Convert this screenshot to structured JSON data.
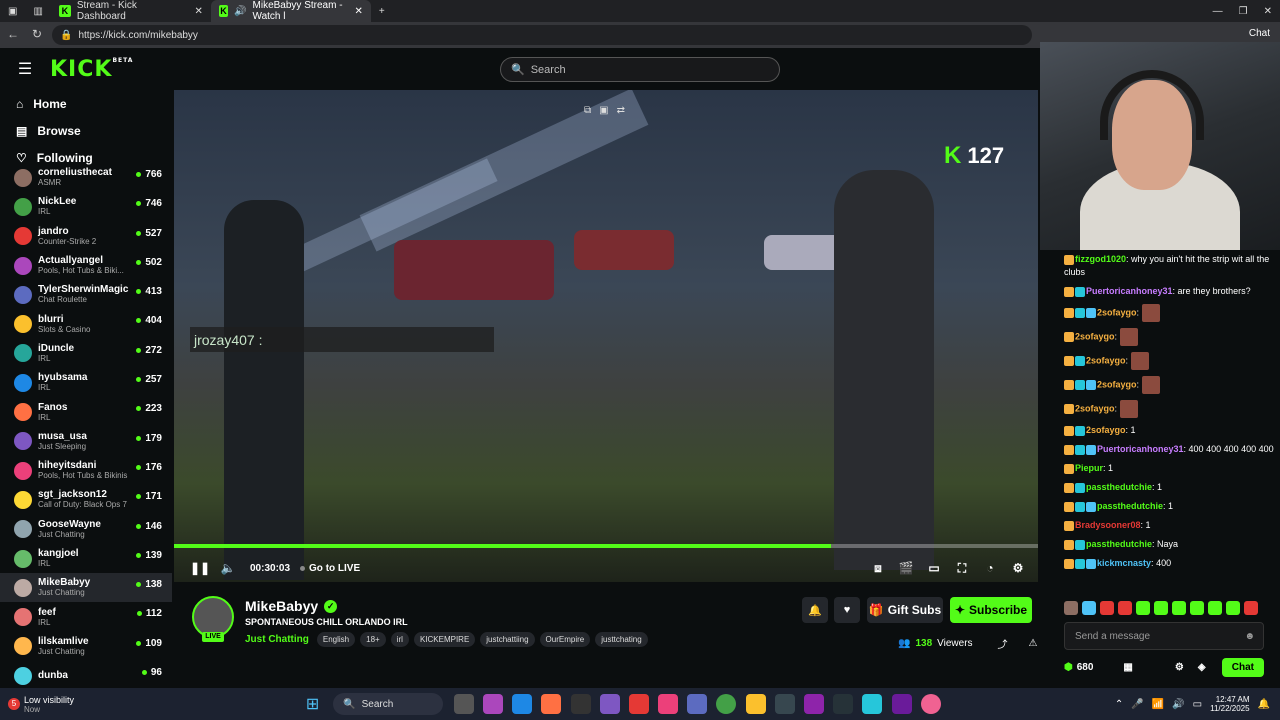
{
  "browser": {
    "tabs": [
      {
        "label": "Stream - Kick Dashboard"
      },
      {
        "label": "MikeBabyy Stream - Watch l"
      }
    ],
    "url": "https://kick.com/mikebabyy",
    "chat_label": "Chat"
  },
  "header": {
    "logo": "KICK",
    "beta": "BETA",
    "search_placeholder": "Search"
  },
  "nav": [
    {
      "label": "Home"
    },
    {
      "label": "Browse"
    },
    {
      "label": "Following"
    }
  ],
  "channels": [
    {
      "name": "corneliusthecat",
      "category": "ASMR",
      "viewers": "766"
    },
    {
      "name": "NickLee",
      "category": "IRL",
      "viewers": "746"
    },
    {
      "name": "jandro",
      "category": "Counter-Strike 2",
      "viewers": "527"
    },
    {
      "name": "Actuallyangel",
      "category": "Pools, Hot Tubs & Biki...",
      "viewers": "502"
    },
    {
      "name": "TylerSherwinMagic",
      "category": "Chat Roulette",
      "viewers": "413"
    },
    {
      "name": "blurri",
      "category": "Slots & Casino",
      "viewers": "404"
    },
    {
      "name": "iDuncle",
      "category": "IRL",
      "viewers": "272"
    },
    {
      "name": "hyubsama",
      "category": "IRL",
      "viewers": "257"
    },
    {
      "name": "Fanos",
      "category": "IRL",
      "viewers": "223"
    },
    {
      "name": "musa_usa",
      "category": "Just Sleeping",
      "viewers": "179"
    },
    {
      "name": "hiheyitsdani",
      "category": "Pools, Hot Tubs & Bikinis",
      "viewers": "176"
    },
    {
      "name": "sgt_jackson12",
      "category": "Call of Duty: Black Ops 7",
      "viewers": "171"
    },
    {
      "name": "GooseWayne",
      "category": "Just Chatting",
      "viewers": "146"
    },
    {
      "name": "kangjoel",
      "category": "IRL",
      "viewers": "139"
    },
    {
      "name": "MikeBabyy",
      "category": "Just Chatting",
      "viewers": "138"
    },
    {
      "name": "feef",
      "category": "IRL",
      "viewers": "112"
    },
    {
      "name": "lilskamlive",
      "category": "Just Chatting",
      "viewers": "109"
    },
    {
      "name": "dunba",
      "category": "",
      "viewers": "96"
    }
  ],
  "video": {
    "k_count": "127",
    "overlay_chat": "jrozay407 :",
    "time": "00:30:03",
    "go_live": "Go to LIVE",
    "progress": 0.76
  },
  "stream": {
    "name": "MikeBabyy",
    "live": "LIVE",
    "title": "SPONTANEOUS CHILL ORLANDO IRL",
    "category": "Just Chatting",
    "tags": [
      "English",
      "18+",
      "irl",
      "KICKEMPIRE",
      "justchattiing",
      "OurEmpire",
      "justtchating"
    ],
    "gift_label": "Gift Subs",
    "subscribe_label": "Subscribe",
    "viewers": "138",
    "viewers_label": "Viewers"
  },
  "chat": {
    "messages": [
      {
        "user": "fizzgod1020",
        "color": "#53fc18",
        "text": "why you ain't hit the strip wit all the clubs"
      },
      {
        "user": "Puertoricanhoney31",
        "color": "#c77dff",
        "text": "are they brothers?"
      },
      {
        "user": "2sofaygo",
        "color": "#f5b041",
        "text": ""
      },
      {
        "user": "2sofaygo",
        "color": "#f5b041",
        "text": ""
      },
      {
        "user": "2sofaygo",
        "color": "#f5b041",
        "text": ""
      },
      {
        "user": "2sofaygo",
        "color": "#f5b041",
        "text": ""
      },
      {
        "user": "2sofaygo",
        "color": "#f5b041",
        "text": ""
      },
      {
        "user": "2sofaygo",
        "color": "#f5b041",
        "text": "1"
      },
      {
        "user": "Puertoricanhoney31",
        "color": "#c77dff",
        "text": "400 400 400 400 400"
      },
      {
        "user": "Piepur",
        "color": "#53fc18",
        "text": "1"
      },
      {
        "user": "passthedutchie",
        "color": "#53fc18",
        "text": "1"
      },
      {
        "user": "passthedutchie",
        "color": "#53fc18",
        "text": "1"
      },
      {
        "user": "Bradysooner08",
        "color": "#e53935",
        "text": "1"
      },
      {
        "user": "passthedutchie",
        "color": "#53fc18",
        "text": "Naya"
      },
      {
        "user": "kickmcnasty",
        "color": "#4fc3f7",
        "text": "400"
      }
    ],
    "input_placeholder": "Send a message",
    "points": "680",
    "chat_button": "Chat"
  },
  "taskbar": {
    "weather": "Low visibility",
    "weather_sub": "Now",
    "search": "Search",
    "time": "12:47 AM",
    "date": "11/22/2025"
  }
}
